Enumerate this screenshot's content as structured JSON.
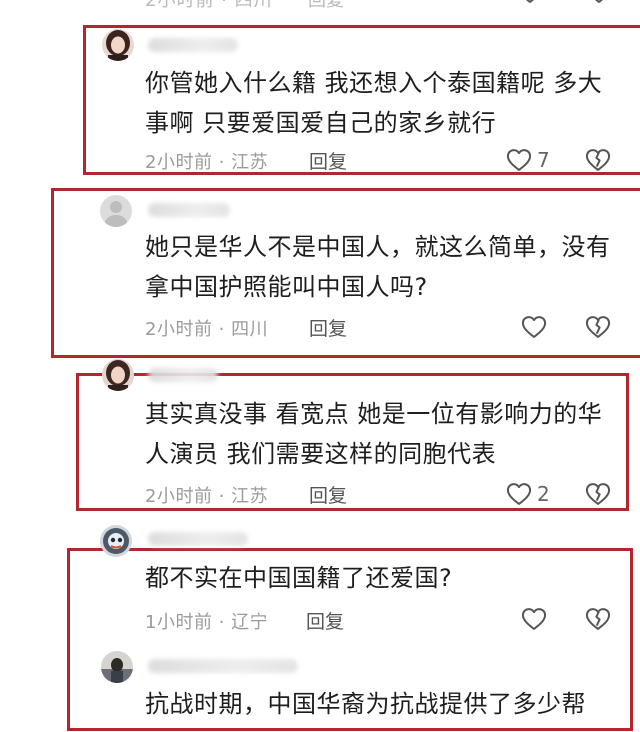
{
  "top_clip": {
    "meta": "2小时前 · 四川",
    "reply": "回复"
  },
  "comments": [
    {
      "text_lines": [
        "你管她入什么籍 我还想入个泰国籍呢 多大",
        "事啊 只要爱国爱自己的家乡就行"
      ],
      "meta": "2小时前 · 江苏",
      "reply": "回复",
      "likes": "7"
    },
    {
      "text_lines": [
        "她只是华人不是中国人，就这么简单，没有",
        "拿中国护照能叫中国人吗?"
      ],
      "meta": "2小时前 · 四川",
      "reply": "回复",
      "likes": ""
    },
    {
      "text_lines": [
        "其实真没事 看宽点 她是一位有影响力的华",
        "人演员 我们需要这样的同胞代表"
      ],
      "meta": "2小时前 · 江苏",
      "reply": "回复",
      "likes": "2"
    },
    {
      "text_lines": [
        "都不实在中国国籍了还爱国?"
      ],
      "meta": "1小时前 · 辽宁",
      "reply": "回复",
      "likes": ""
    },
    {
      "text_lines": [
        "抗战时期，中国华裔为抗战提供了多少帮"
      ],
      "meta": "",
      "reply": "",
      "likes": ""
    }
  ],
  "colors": {
    "highlight_box": "#b3262c",
    "meta_text": "#9b9b9b",
    "body_text": "#1e1e1e"
  },
  "icons": {
    "like": "heart-outline-icon",
    "dislike": "broken-heart-icon"
  }
}
